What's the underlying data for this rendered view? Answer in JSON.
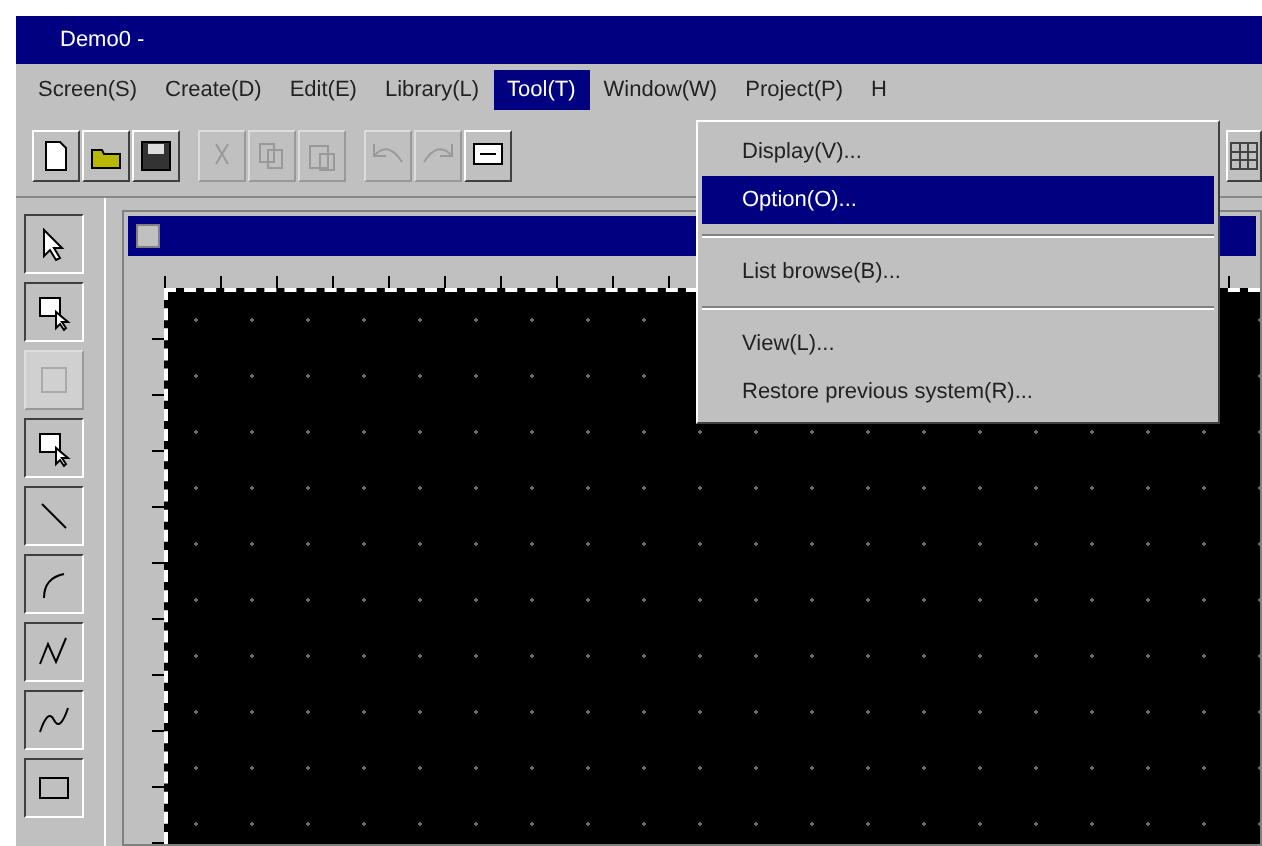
{
  "window": {
    "title": "Demo0 -"
  },
  "menubar": [
    {
      "label": "Screen(S)",
      "selected": false
    },
    {
      "label": "Create(D)",
      "selected": false
    },
    {
      "label": "Edit(E)",
      "selected": false
    },
    {
      "label": "Library(L)",
      "selected": false
    },
    {
      "label": "Tool(T)",
      "selected": true
    },
    {
      "label": "Window(W)",
      "selected": false
    },
    {
      "label": "Project(P)",
      "selected": false
    },
    {
      "label": "H",
      "selected": false
    }
  ],
  "toolbar": [
    {
      "kind": "new",
      "disabled": false
    },
    {
      "kind": "open",
      "disabled": false
    },
    {
      "kind": "save",
      "disabled": false
    },
    {
      "kind": "cut",
      "disabled": true
    },
    {
      "kind": "copy",
      "disabled": true
    },
    {
      "kind": "paste",
      "disabled": true
    },
    {
      "kind": "undo",
      "disabled": true
    },
    {
      "kind": "redo",
      "disabled": true
    },
    {
      "kind": "screen",
      "disabled": false
    }
  ],
  "tools": [
    {
      "kind": "pointer",
      "disabled": false
    },
    {
      "kind": "select",
      "disabled": false
    },
    {
      "kind": "group",
      "disabled": true
    },
    {
      "kind": "select",
      "disabled": false
    },
    {
      "kind": "line",
      "disabled": false
    },
    {
      "kind": "arc",
      "disabled": false
    },
    {
      "kind": "polyline",
      "disabled": false
    },
    {
      "kind": "curve",
      "disabled": false
    },
    {
      "kind": "rect",
      "disabled": false
    }
  ],
  "dropdown": {
    "groups": [
      [
        {
          "label": "Display(V)...",
          "selected": false
        },
        {
          "label": "Option(O)...",
          "selected": true
        }
      ],
      [
        {
          "label": "List browse(B)...",
          "selected": false
        }
      ],
      [
        {
          "label": "View(L)...",
          "selected": false
        },
        {
          "label": "Restore previous system(R)...",
          "selected": false
        }
      ]
    ]
  }
}
